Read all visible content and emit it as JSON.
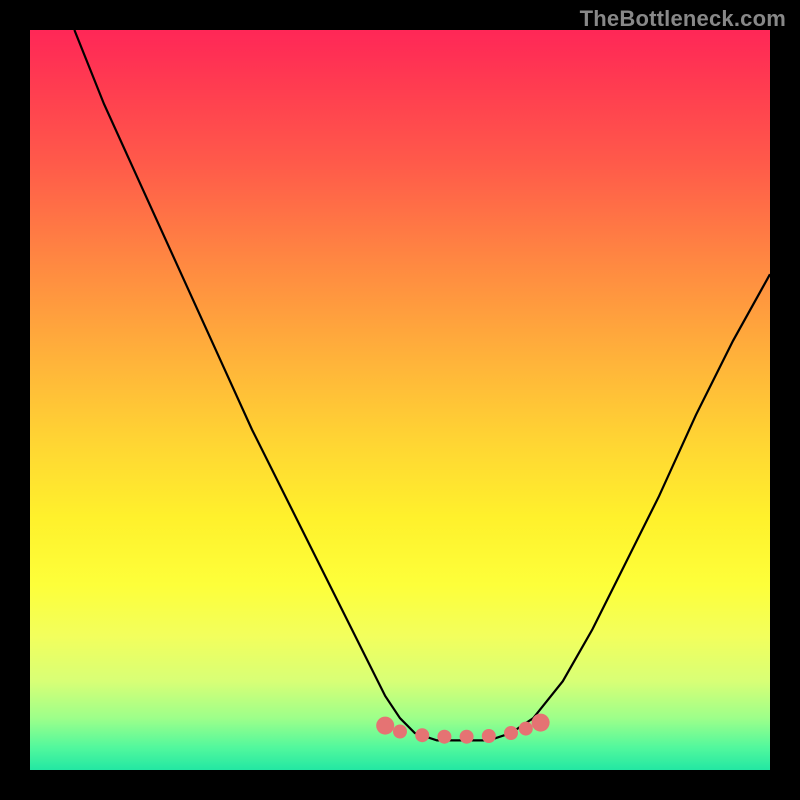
{
  "watermark": "TheBottleneck.com",
  "chart_data": {
    "type": "line",
    "title": "",
    "xlabel": "",
    "ylabel": "",
    "xlim": [
      0,
      100
    ],
    "ylim": [
      0,
      100
    ],
    "grid": false,
    "legend": false,
    "series": [
      {
        "name": "bottleneck-curve",
        "x": [
          6,
          10,
          15,
          20,
          25,
          30,
          35,
          40,
          45,
          48,
          50,
          52,
          55,
          58,
          60,
          62,
          65,
          68,
          72,
          76,
          80,
          85,
          90,
          95,
          100
        ],
        "y": [
          100,
          90,
          79,
          68,
          57,
          46,
          36,
          26,
          16,
          10,
          7,
          5,
          4,
          4,
          4,
          4,
          5,
          7,
          12,
          19,
          27,
          37,
          48,
          58,
          67
        ]
      },
      {
        "name": "target-markers",
        "x": [
          48,
          50,
          53,
          56,
          59,
          62,
          65,
          67,
          69
        ],
        "y": [
          6.0,
          5.2,
          4.7,
          4.5,
          4.5,
          4.6,
          5.0,
          5.6,
          6.4
        ]
      }
    ],
    "gradient_stops": [
      {
        "pos": 0.0,
        "color": "#ff2757"
      },
      {
        "pos": 0.18,
        "color": "#ff5a4a"
      },
      {
        "pos": 0.45,
        "color": "#ffb43a"
      },
      {
        "pos": 0.66,
        "color": "#fff12c"
      },
      {
        "pos": 0.88,
        "color": "#d8ff76"
      },
      {
        "pos": 1.0,
        "color": "#23e7a3"
      }
    ]
  }
}
